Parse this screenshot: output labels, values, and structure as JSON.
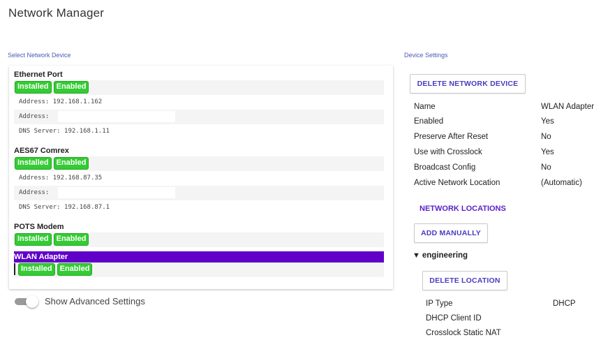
{
  "title": "Network Manager",
  "select_label": "Select Network Device",
  "settings_label": "Device Settings",
  "devices": [
    {
      "name": "Ethernet Port",
      "badges": [
        "Installed",
        "Enabled"
      ],
      "info": [
        "Address: 192.168.1.162",
        "Address:",
        "DNS Server: 192.168.1.11"
      ]
    },
    {
      "name": "AES67 Comrex",
      "badges": [
        "Installed",
        "Enabled"
      ],
      "info": [
        "Address: 192.168.87.35",
        "Address:",
        "DNS Server: 192.168.87.1"
      ]
    },
    {
      "name": "POTS Modem",
      "badges": [
        "Installed",
        "Enabled"
      ]
    },
    {
      "name": "WLAN Adapter",
      "badges": [
        "Installed",
        "Enabled"
      ],
      "selected": true
    }
  ],
  "advanced_toggle": {
    "label": "Show Advanced Settings",
    "on": false
  },
  "settings": {
    "delete_device_label": "DELETE NETWORK DEVICE",
    "fields": [
      {
        "key": "Name",
        "value": "WLAN Adapter"
      },
      {
        "key": "Enabled",
        "value": "Yes"
      },
      {
        "key": "Preserve After Reset",
        "value": "No"
      },
      {
        "key": "Use with Crosslock",
        "value": "Yes"
      },
      {
        "key": "Broadcast Config",
        "value": "No"
      },
      {
        "key": "Active Network Location",
        "value": "(Automatic)"
      }
    ],
    "network_locations_title": "NETWORK LOCATIONS",
    "add_manually_label": "ADD MANUALLY",
    "location": {
      "expand_glyph": "▼",
      "name": "engineering",
      "delete_label": "DELETE LOCATION",
      "fields": [
        {
          "key": "IP Type",
          "value": "DHCP"
        },
        {
          "key": "DHCP Client ID",
          "value": ""
        },
        {
          "key": "Crosslock Static NAT",
          "value": ""
        }
      ]
    }
  },
  "colors": {
    "badge_green": "#33cc33",
    "selected_purple": "#6000c8",
    "accent_text": "#4a3cc0"
  }
}
